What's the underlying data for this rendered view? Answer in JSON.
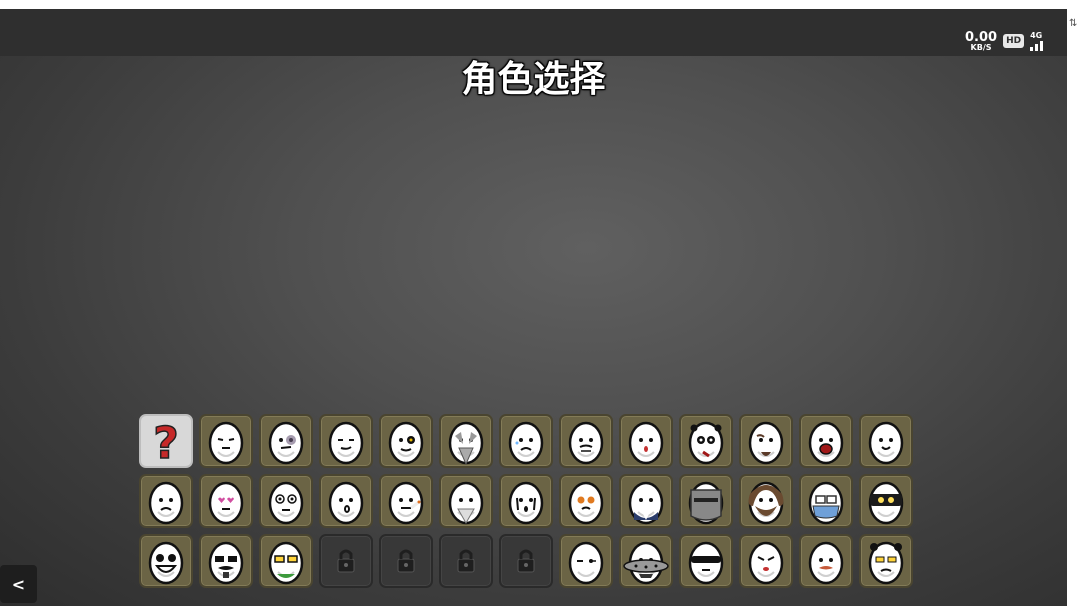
{
  "status_bar": {
    "speed_value": "0.00",
    "speed_unit": "KB/S",
    "hd_badge": "HD",
    "network": "4G"
  },
  "title": "角色选择",
  "back_button_label": "<",
  "characters": [
    {
      "kind": "random",
      "face": "question-mark"
    },
    {
      "kind": "egg",
      "face": "grumpy"
    },
    {
      "kind": "egg",
      "face": "bruised"
    },
    {
      "kind": "egg",
      "face": "smug"
    },
    {
      "kind": "egg",
      "face": "eyepatch"
    },
    {
      "kind": "egg",
      "face": "bearded-elder"
    },
    {
      "kind": "egg",
      "face": "teary"
    },
    {
      "kind": "egg",
      "face": "sad-mustache"
    },
    {
      "kind": "egg",
      "face": "surprised"
    },
    {
      "kind": "egg",
      "face": "panda"
    },
    {
      "kind": "egg",
      "face": "goateed"
    },
    {
      "kind": "egg",
      "face": "screaming"
    },
    {
      "kind": "egg",
      "face": "happy"
    },
    {
      "kind": "egg",
      "face": "worried"
    },
    {
      "kind": "egg",
      "face": "heart-eyes"
    },
    {
      "kind": "egg",
      "face": "big-eyes"
    },
    {
      "kind": "egg",
      "face": "shocked"
    },
    {
      "kind": "egg",
      "face": "smoker"
    },
    {
      "kind": "egg",
      "face": "wizard-beard"
    },
    {
      "kind": "egg",
      "face": "crying"
    },
    {
      "kind": "egg",
      "face": "orange-goggles"
    },
    {
      "kind": "egg",
      "face": "suit"
    },
    {
      "kind": "egg",
      "face": "knight-helmet"
    },
    {
      "kind": "egg",
      "face": "hairy-beard"
    },
    {
      "kind": "egg",
      "face": "surgical-mask"
    },
    {
      "kind": "egg",
      "face": "ninja"
    },
    {
      "kind": "egg",
      "face": "grin-glasses"
    },
    {
      "kind": "egg",
      "face": "mustache-shades"
    },
    {
      "kind": "egg",
      "face": "yellow-glasses"
    },
    {
      "kind": "locked",
      "face": "lock"
    },
    {
      "kind": "locked",
      "face": "lock"
    },
    {
      "kind": "locked",
      "face": "lock"
    },
    {
      "kind": "locked",
      "face": "lock"
    },
    {
      "kind": "egg",
      "face": "sleepy"
    },
    {
      "kind": "egg",
      "face": "ufo"
    },
    {
      "kind": "egg",
      "face": "visor"
    },
    {
      "kind": "egg",
      "face": "angry"
    },
    {
      "kind": "egg",
      "face": "red-mustache"
    },
    {
      "kind": "egg",
      "face": "panda-frown"
    }
  ],
  "colors": {
    "slot_bg": "#6b6445",
    "locked_bg": "#383838",
    "random_bg": "#d8d8d8",
    "question_mark": "#c62828"
  }
}
